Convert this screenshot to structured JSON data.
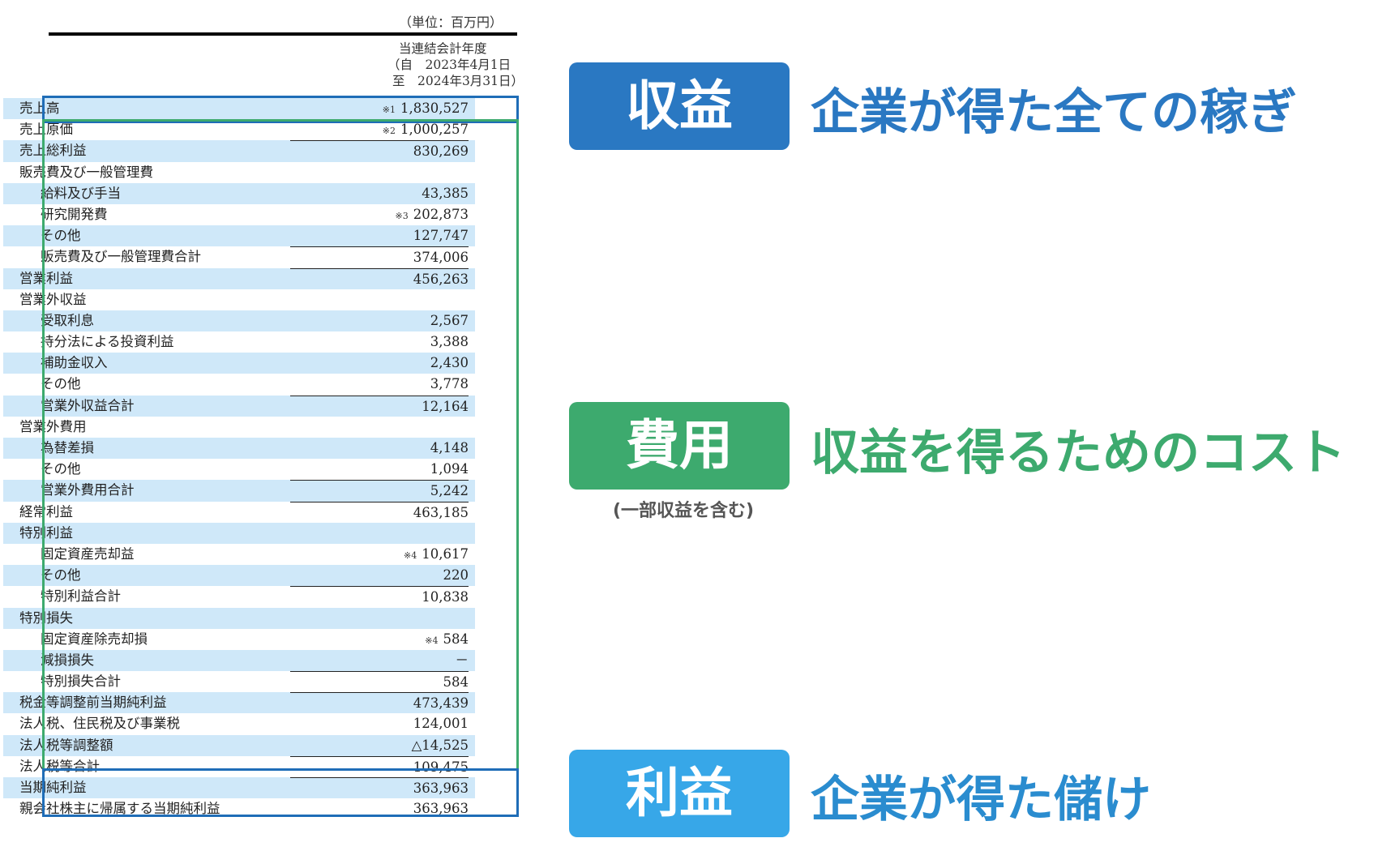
{
  "statement": {
    "unit_label": "（単位：百万円）",
    "period": {
      "title": "当連結会計年度",
      "from": "（自　2023年4月1日",
      "to": "至　2024年3月31日）"
    },
    "rows": [
      {
        "label": "売上高",
        "note": "※1",
        "value": "1,830,527",
        "indent": false,
        "top_line": false,
        "shaded": true
      },
      {
        "label": "売上原価",
        "note": "※2",
        "value": "1,000,257",
        "indent": false,
        "top_line": false,
        "shaded": false
      },
      {
        "label": "売上総利益",
        "note": "",
        "value": "830,269",
        "indent": false,
        "top_line": true,
        "shaded": true
      },
      {
        "label": "販売費及び一般管理費",
        "note": "",
        "value": "",
        "indent": false,
        "top_line": false,
        "shaded": false
      },
      {
        "label": "給料及び手当",
        "note": "",
        "value": "43,385",
        "indent": true,
        "top_line": false,
        "shaded": true
      },
      {
        "label": "研究開発費",
        "note": "※3",
        "value": "202,873",
        "indent": true,
        "top_line": false,
        "shaded": false
      },
      {
        "label": "その他",
        "note": "",
        "value": "127,747",
        "indent": true,
        "top_line": false,
        "shaded": true
      },
      {
        "label": "販売費及び一般管理費合計",
        "note": "",
        "value": "374,006",
        "indent": true,
        "top_line": true,
        "shaded": false
      },
      {
        "label": "営業利益",
        "note": "",
        "value": "456,263",
        "indent": false,
        "top_line": true,
        "shaded": true
      },
      {
        "label": "営業外収益",
        "note": "",
        "value": "",
        "indent": false,
        "top_line": false,
        "shaded": false
      },
      {
        "label": "受取利息",
        "note": "",
        "value": "2,567",
        "indent": true,
        "top_line": false,
        "shaded": true
      },
      {
        "label": "持分法による投資利益",
        "note": "",
        "value": "3,388",
        "indent": true,
        "top_line": false,
        "shaded": false
      },
      {
        "label": "補助金収入",
        "note": "",
        "value": "2,430",
        "indent": true,
        "top_line": false,
        "shaded": true
      },
      {
        "label": "その他",
        "note": "",
        "value": "3,778",
        "indent": true,
        "top_line": false,
        "shaded": false
      },
      {
        "label": "営業外収益合計",
        "note": "",
        "value": "12,164",
        "indent": true,
        "top_line": true,
        "shaded": true
      },
      {
        "label": "営業外費用",
        "note": "",
        "value": "",
        "indent": false,
        "top_line": false,
        "shaded": false
      },
      {
        "label": "為替差損",
        "note": "",
        "value": "4,148",
        "indent": true,
        "top_line": false,
        "shaded": true
      },
      {
        "label": "その他",
        "note": "",
        "value": "1,094",
        "indent": true,
        "top_line": false,
        "shaded": false
      },
      {
        "label": "営業外費用合計",
        "note": "",
        "value": "5,242",
        "indent": true,
        "top_line": true,
        "shaded": true
      },
      {
        "label": "経常利益",
        "note": "",
        "value": "463,185",
        "indent": false,
        "top_line": true,
        "shaded": false
      },
      {
        "label": "特別利益",
        "note": "",
        "value": "",
        "indent": false,
        "top_line": false,
        "shaded": true
      },
      {
        "label": "固定資産売却益",
        "note": "※4",
        "value": "10,617",
        "indent": true,
        "top_line": false,
        "shaded": false
      },
      {
        "label": "その他",
        "note": "",
        "value": "220",
        "indent": true,
        "top_line": false,
        "shaded": true
      },
      {
        "label": "特別利益合計",
        "note": "",
        "value": "10,838",
        "indent": true,
        "top_line": true,
        "shaded": false
      },
      {
        "label": "特別損失",
        "note": "",
        "value": "",
        "indent": false,
        "top_line": false,
        "shaded": true
      },
      {
        "label": "固定資産除売却損",
        "note": "※4",
        "value": "584",
        "indent": true,
        "top_line": false,
        "shaded": false
      },
      {
        "label": "減損損失",
        "note": "",
        "value": "－",
        "indent": true,
        "top_line": false,
        "shaded": true
      },
      {
        "label": "特別損失合計",
        "note": "",
        "value": "584",
        "indent": true,
        "top_line": true,
        "shaded": false
      },
      {
        "label": "税金等調整前当期純利益",
        "note": "",
        "value": "473,439",
        "indent": false,
        "top_line": true,
        "shaded": true
      },
      {
        "label": "法人税、住民税及び事業税",
        "note": "",
        "value": "124,001",
        "indent": false,
        "top_line": false,
        "shaded": false
      },
      {
        "label": "法人税等調整額",
        "note": "",
        "value": "△14,525",
        "indent": false,
        "top_line": false,
        "shaded": true
      },
      {
        "label": "法人税等合計",
        "note": "",
        "value": "109,475",
        "indent": false,
        "top_line": true,
        "shaded": false
      },
      {
        "label": "当期純利益",
        "note": "",
        "value": "363,963",
        "indent": false,
        "top_line": true,
        "shaded": true
      },
      {
        "label": "親会社株主に帰属する当期純利益",
        "note": "",
        "value": "363,963",
        "indent": false,
        "top_line": false,
        "shaded": false
      }
    ]
  },
  "callouts": {
    "revenue": {
      "badge": "収益",
      "description": "企業が得た全ての稼ぎ",
      "color": "#2a78c2"
    },
    "expense": {
      "badge": "費用",
      "description": "収益を得るためのコスト",
      "sub_note": "(一部収益を含む)",
      "color": "#3daa6e"
    },
    "profit": {
      "badge": "利益",
      "description": "企業が得た儲け",
      "color": "#37a7e8"
    }
  },
  "colors": {
    "revenue_frame": "#1f6db7",
    "expense_frame": "#3daa6e",
    "profit_frame": "#1f6db7",
    "row_shade": "#cfe8f9"
  }
}
